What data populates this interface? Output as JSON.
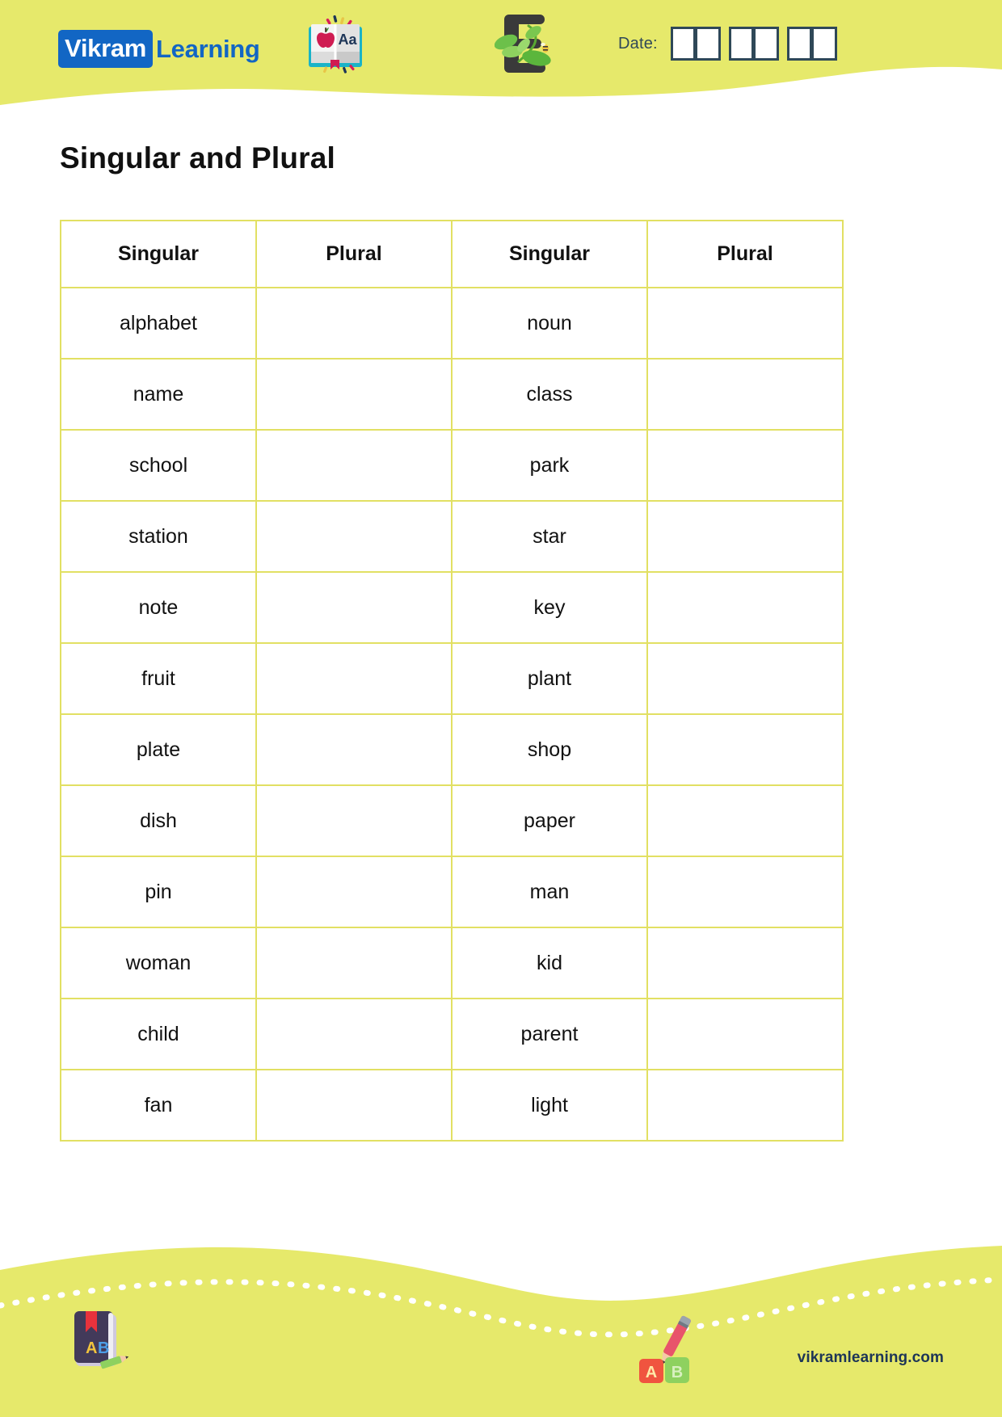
{
  "header": {
    "brand_prefix": "Vikram",
    "brand_suffix": "Learning",
    "date_label": "Date:",
    "date_boxes": [
      "",
      "",
      "",
      "",
      "",
      ""
    ],
    "book_icon_name": "open-book-apple-icon",
    "e_logo_name": "e-leaf-logo-icon",
    "colors": {
      "band": "#e6e96b",
      "brand_blue": "#1266c4",
      "date_navy": "#2f4858"
    }
  },
  "title": "Singular and Plural",
  "table": {
    "headers": [
      "Singular",
      "Plural",
      "Singular",
      "Plural"
    ],
    "rows": [
      {
        "left_singular": "alphabet",
        "left_plural": "",
        "right_singular": "noun",
        "right_plural": ""
      },
      {
        "left_singular": "name",
        "left_plural": "",
        "right_singular": "class",
        "right_plural": ""
      },
      {
        "left_singular": "school",
        "left_plural": "",
        "right_singular": "park",
        "right_plural": ""
      },
      {
        "left_singular": "station",
        "left_plural": "",
        "right_singular": "star",
        "right_plural": ""
      },
      {
        "left_singular": "note",
        "left_plural": "",
        "right_singular": "key",
        "right_plural": ""
      },
      {
        "left_singular": "fruit",
        "left_plural": "",
        "right_singular": "plant",
        "right_plural": ""
      },
      {
        "left_singular": "plate",
        "left_plural": "",
        "right_singular": "shop",
        "right_plural": ""
      },
      {
        "left_singular": "dish",
        "left_plural": "",
        "right_singular": "paper",
        "right_plural": ""
      },
      {
        "left_singular": "pin",
        "left_plural": "",
        "right_singular": "man",
        "right_plural": ""
      },
      {
        "left_singular": "woman",
        "left_plural": "",
        "right_singular": "kid",
        "right_plural": ""
      },
      {
        "left_singular": "child",
        "left_plural": "",
        "right_singular": "parent",
        "right_plural": ""
      },
      {
        "left_singular": "fan",
        "left_plural": "",
        "right_singular": "light",
        "right_plural": ""
      }
    ],
    "border_color": "#e2e063"
  },
  "footer": {
    "site_url": "vikramlearning.com",
    "ab_book_icon_name": "ab-book-pencil-icon",
    "ab_blocks_icon_name": "ab-blocks-pencil-icon",
    "letter_a": "A",
    "letter_b": "B",
    "colors": {
      "band": "#e6e96b",
      "url_navy": "#1d3557"
    }
  }
}
